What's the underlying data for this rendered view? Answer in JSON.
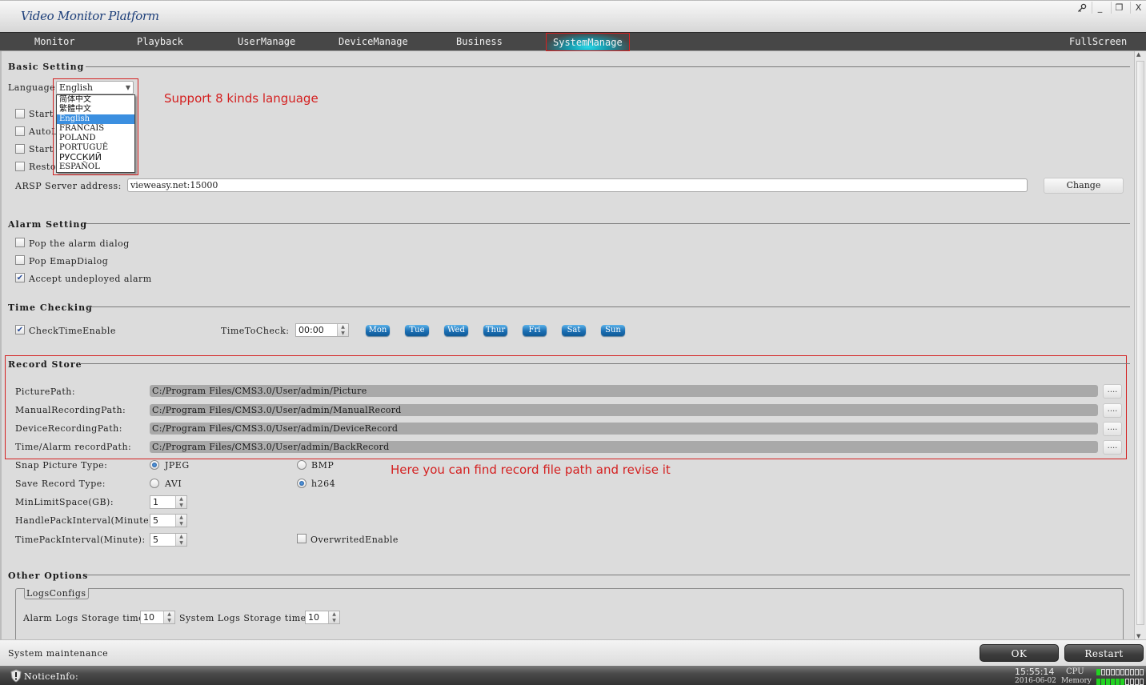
{
  "window": {
    "title": "Video Monitor Platform",
    "controls": {
      "key": "key-icon",
      "minimize": "_",
      "restore": "❐",
      "close": "X"
    }
  },
  "nav": {
    "items": [
      {
        "label": "Monitor"
      },
      {
        "label": "Playback"
      },
      {
        "label": "UserManage"
      },
      {
        "label": "DeviceManage"
      },
      {
        "label": "Business"
      },
      {
        "label": "SystemManage",
        "active": true
      }
    ],
    "fullscreen": "FullScreen"
  },
  "basic_setting": {
    "title": "Basic Setting",
    "language_label": "Language:",
    "language_value": "English",
    "language_options": [
      "简体中文",
      "繁體中文",
      "English",
      "FRANCAIS",
      "POLAND",
      "PORTUGUÊ",
      "РУССКИЙ",
      "ESPAÑOL"
    ],
    "language_selected_index": 2,
    "checkboxes": [
      {
        "label": "Start",
        "checked": false
      },
      {
        "label": "AutoLo",
        "checked": false
      },
      {
        "label": "Start",
        "checked": false
      },
      {
        "label": "Resto",
        "checked": false
      }
    ],
    "server_label": "ARSP Server address:",
    "server_value": "vieweasy.net:15000",
    "change_button": "Change"
  },
  "annotations": {
    "language_note": "Support 8 kinds language",
    "record_note": "Here you can find record file path and revise it"
  },
  "alarm_setting": {
    "title": "Alarm Setting",
    "checkboxes": [
      {
        "label": "Pop the alarm dialog",
        "checked": false
      },
      {
        "label": "Pop EmapDialog",
        "checked": false
      },
      {
        "label": "Accept undeployed alarm",
        "checked": true
      }
    ]
  },
  "time_checking": {
    "title": "Time Checking",
    "enable_label": "CheckTimeEnable",
    "enable_checked": true,
    "time_label": "TimeToCheck:",
    "time_value": "00:00",
    "days": [
      "Mon",
      "Tue",
      "Wed",
      "Thur",
      "Fri",
      "Sat",
      "Sun"
    ]
  },
  "record_store": {
    "title": "Record Store",
    "paths": [
      {
        "label": "PicturePath:",
        "value": "C:/Program Files/CMS3.0/User/admin/Picture"
      },
      {
        "label": "ManualRecordingPath:",
        "value": "C:/Program Files/CMS3.0/User/admin/ManualRecord"
      },
      {
        "label": "DeviceRecordingPath:",
        "value": "C:/Program Files/CMS3.0/User/admin/DeviceRecord"
      },
      {
        "label": "Time/Alarm recordPath:",
        "value": "C:/Program Files/CMS3.0/User/admin/BackRecord"
      }
    ],
    "browse_label": "....",
    "snap_label": "Snap Picture Type:",
    "snap_options": [
      {
        "label": "JPEG",
        "selected": true
      },
      {
        "label": "BMP",
        "selected": false
      }
    ],
    "save_label": "Save Record Type:",
    "save_options": [
      {
        "label": "AVI",
        "selected": false
      },
      {
        "label": "h264",
        "selected": true
      }
    ],
    "min_space_label": "MinLimitSpace(GB):",
    "min_space_value": "1",
    "handle_pack_label": "HandlePackInterval(Minute):",
    "handle_pack_value": "5",
    "time_pack_label": "TimePackInterval(Minute):",
    "time_pack_value": "5",
    "overwrite_label": "OverwritedEnable",
    "overwrite_checked": false
  },
  "other_options": {
    "title": "Other Options",
    "group_title": "LogsConfigs",
    "alarm_logs_label": "Alarm Logs Storage time",
    "alarm_logs_value": "10",
    "system_logs_label": "System Logs Storage time:",
    "system_logs_value": "10"
  },
  "bottom": {
    "section": "System maintenance",
    "ok": "OK",
    "restart": "Restart"
  },
  "status": {
    "notice_label": "NoticeInfo:",
    "time": "15:55:14",
    "date": "2016-06-02",
    "cpu_label": "CPU",
    "cpu_level": 0.1,
    "memory_label": "Memory",
    "memory_level": 0.6
  }
}
